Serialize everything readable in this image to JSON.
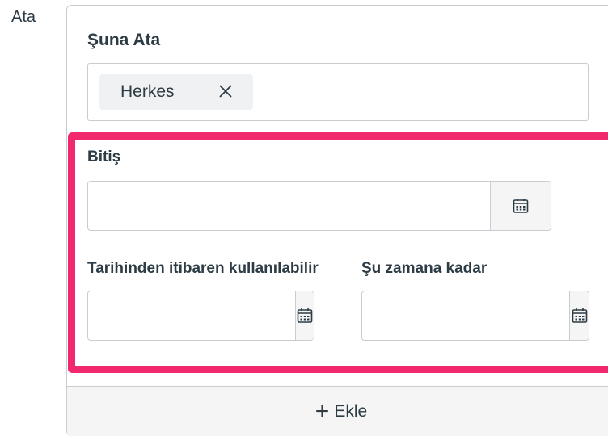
{
  "row_label": "Ata",
  "assign_to": {
    "label": "Şuna Ata",
    "tokens": [
      {
        "label": "Herkes"
      }
    ]
  },
  "due": {
    "label": "Bitiş",
    "value": ""
  },
  "available_from": {
    "label": "Tarihinden itibaren kullanılabilir",
    "value": ""
  },
  "until": {
    "label": "Şu zamana kadar",
    "value": ""
  },
  "add_button": {
    "label": "Ekle"
  },
  "colors": {
    "highlight": "#f2286f",
    "text": "#2d3b45",
    "border": "#c7cdd1"
  }
}
